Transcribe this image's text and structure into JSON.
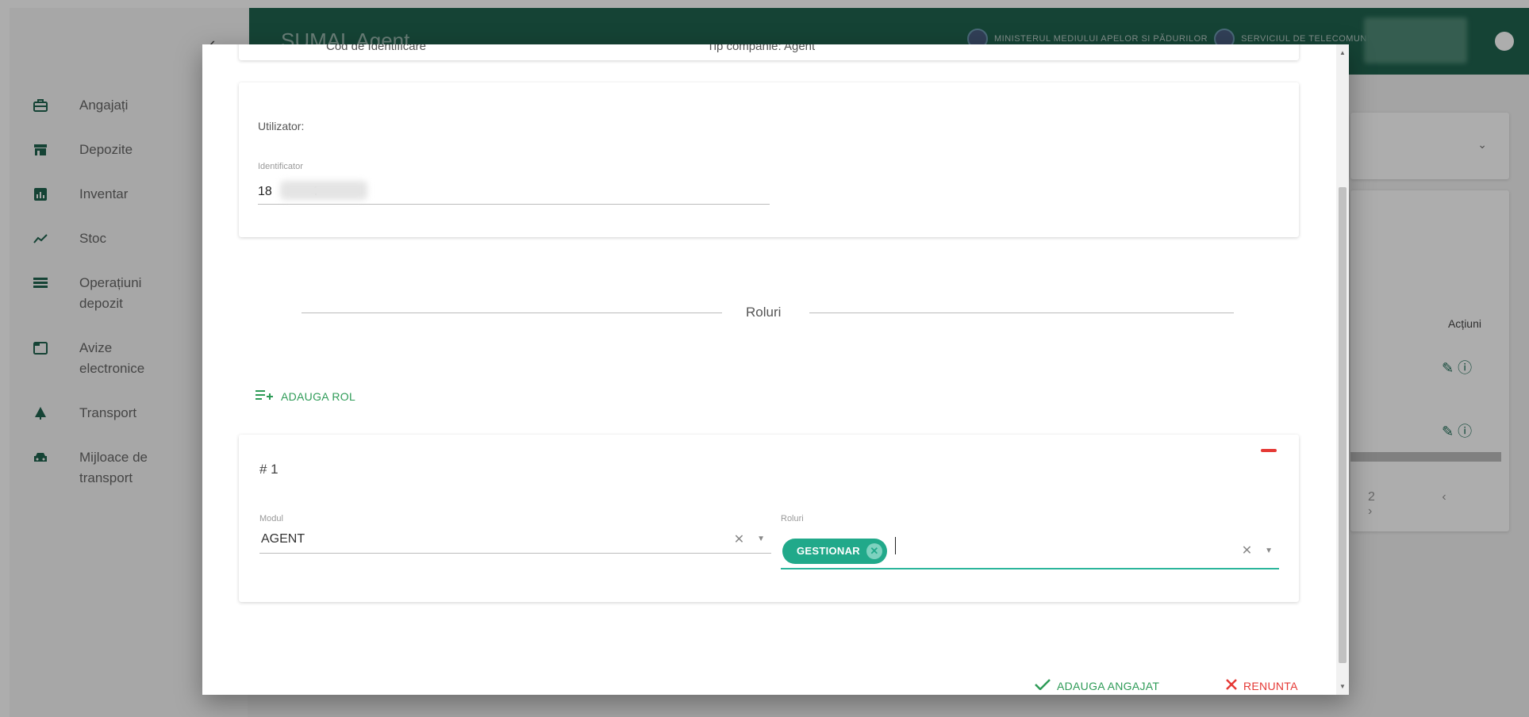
{
  "app": {
    "title": "SUMAL Agent",
    "ministry_labels": [
      "MINISTERUL MEDIULUI APELOR SI PĂDURILOR",
      "SERVICIUL DE TELECOMUNICAȚII"
    ],
    "collapse_glyph": "‹"
  },
  "sidebar": {
    "items": [
      {
        "label": "Angajați",
        "icon": "briefcase-icon"
      },
      {
        "label": "Depozite",
        "icon": "store-icon"
      },
      {
        "label": "Inventar",
        "icon": "inventory-icon"
      },
      {
        "label": "Stoc",
        "icon": "trending-up-icon"
      },
      {
        "label": "Operațiuni\ndepozit",
        "icon": "list-icon"
      },
      {
        "label": "Avize\nelectronice",
        "icon": "document-icon"
      },
      {
        "label": "Transport",
        "icon": "tree-icon"
      },
      {
        "label": "Mijloace de\ntransport",
        "icon": "car-icon"
      }
    ]
  },
  "background": {
    "actions_header": "Acțiuni",
    "pager": "2  ‹  ›"
  },
  "modal": {
    "top_card_cut": [
      "Cod de Identificare",
      "Tip companie: Agent"
    ],
    "user_section_title": "Utilizator:",
    "identifier_label": "Identificator",
    "identifier_value": "18           4",
    "roles_title": "Roluri",
    "add_role_label": "ADAUGA ROL",
    "role_card": {
      "index": "# 1",
      "module_label": "Modul",
      "module_value": "AGENT",
      "roles_label": "Roluri",
      "role_chip": "GESTIONAR"
    },
    "confirm_label": "ADAUGA ANGAJAT",
    "cancel_label": "RENUNTA"
  },
  "colors": {
    "header_green": "#20634f",
    "chip_teal": "#21a98a",
    "action_green": "#2e9b57",
    "cancel_red": "#e53935"
  }
}
